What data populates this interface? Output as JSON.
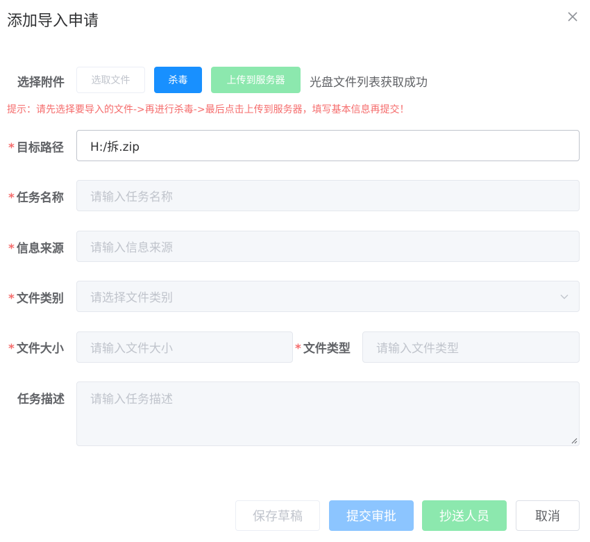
{
  "dialog": {
    "title": "添加导入申请"
  },
  "attachment": {
    "label": "选择附件",
    "pick_label": "选取文件",
    "virus_label": "杀毒",
    "upload_label": "上传到服务器",
    "status": "光盘文件列表获取成功",
    "hint": "提示：请先选择要导入的文件->再进行杀毒->最后点击上传到服务器，填写基本信息再提交！"
  },
  "form": {
    "required_mark": "*",
    "target_path": {
      "label": "目标路径",
      "value": "H:/拆.zip"
    },
    "task_name": {
      "label": "任务名称",
      "placeholder": "请输入任务名称"
    },
    "info_source": {
      "label": "信息来源",
      "placeholder": "请输入信息来源"
    },
    "file_category": {
      "label": "文件类别",
      "placeholder": "请选择文件类别"
    },
    "file_size": {
      "label": "文件大小",
      "placeholder": "请输入文件大小"
    },
    "file_type": {
      "label": "文件类型",
      "placeholder": "请输入文件类型"
    },
    "task_desc": {
      "label": "任务描述",
      "placeholder": "请输入任务描述"
    }
  },
  "footer": {
    "save_draft": "保存草稿",
    "submit": "提交审批",
    "cc": "抄送人员",
    "cancel": "取消"
  },
  "colors": {
    "primary": "#1890ff",
    "success_light": "#8ce8ae",
    "primary_light": "#8cc5ff",
    "danger": "#f56c6c"
  },
  "icons": [
    "close-icon",
    "chevron-down-icon",
    "resize-handle-icon"
  ]
}
